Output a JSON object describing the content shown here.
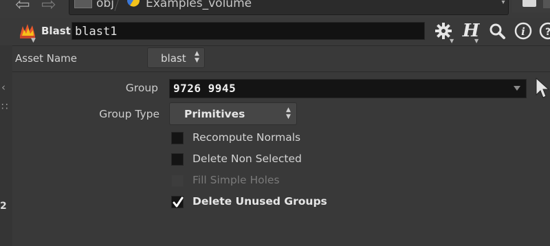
{
  "nav": {
    "crumbs": [
      {
        "label": "obj"
      },
      {
        "label": "Examples_volume"
      }
    ]
  },
  "header": {
    "node_type": "Blast",
    "node_name": "blast1"
  },
  "asset": {
    "label": "Asset Name",
    "value": "blast"
  },
  "params": {
    "group": {
      "label": "Group",
      "value": "9726 9945"
    },
    "group_type": {
      "label": "Group Type",
      "value": "Primitives"
    },
    "checkboxes": [
      {
        "label": "Recompute Normals",
        "checked": false,
        "enabled": true
      },
      {
        "label": "Delete Non Selected",
        "checked": false,
        "enabled": true
      },
      {
        "label": "Fill Simple Holes",
        "checked": false,
        "enabled": false
      },
      {
        "label": "Delete Unused Groups",
        "checked": true,
        "enabled": true
      }
    ]
  },
  "colors": {
    "background": "#393939",
    "field": "#141414",
    "accent": "#e8582c"
  },
  "icons": [
    "back-arrow-icon",
    "forward-arrow-icon",
    "network-path-icon",
    "volume-object-icon",
    "blast-node-icon",
    "gear-icon",
    "houdini-h-icon",
    "zoom-icon",
    "info-icon",
    "help-icon",
    "arrow-pointer-icon"
  ]
}
